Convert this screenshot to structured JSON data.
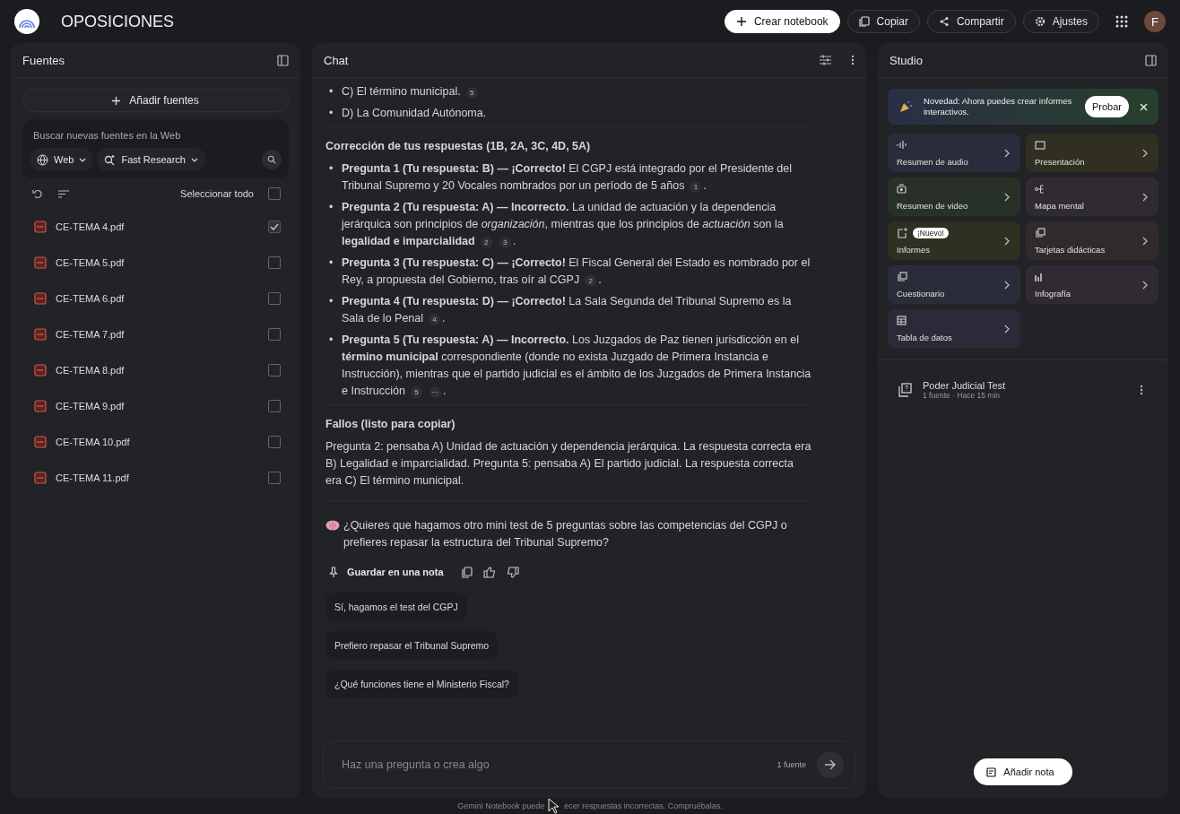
{
  "header": {
    "title": "OPOSICIONES",
    "buttons": [
      {
        "kind": "create",
        "label": "Crear notebook"
      },
      {
        "kind": "copy",
        "label": "Copiar"
      },
      {
        "kind": "share",
        "label": "Compartir"
      },
      {
        "kind": "settings",
        "label": "Ajustes"
      }
    ],
    "avatar": "F"
  },
  "sources": {
    "title": "Fuentes",
    "add_button": "Añadir fuentes",
    "search": {
      "placeholder": "Buscar nuevas fuentes en la Web",
      "web_button": "Web",
      "research_button": "Fast Research"
    },
    "select_all": {
      "label": "Seleccionar todo",
      "checked": false
    },
    "items": [
      {
        "name": "CE-TEMA 4.pdf",
        "checked": true
      },
      {
        "name": "CE-TEMA 5.pdf",
        "checked": false
      },
      {
        "name": "CE-TEMA 6.pdf",
        "checked": false
      },
      {
        "name": "CE-TEMA 7.pdf",
        "checked": false
      },
      {
        "name": "CE-TEMA 8.pdf",
        "checked": false
      },
      {
        "name": "CE-TEMA 9.pdf",
        "checked": false
      },
      {
        "name": "CE-TEMA 10.pdf",
        "checked": false
      },
      {
        "name": "CE-TEMA 11.pdf",
        "checked": false
      }
    ]
  },
  "chat": {
    "title": "Chat",
    "options": [
      {
        "text": "C) El término municipal.",
        "citations": [
          "5"
        ]
      },
      {
        "text": "D) La Comunidad Autónoma."
      }
    ],
    "bullet": "•",
    "correction_heading": "Corrección de tus respuestas (1B, 2A, 3C, 4D, 5A)",
    "corrections": [
      {
        "text": "**Pregunta 1 (Tu respuesta: B) — ¡Correcto!** El CGPJ está integrado por el Presidente del Tribunal Supremo y 20 Vocales nombrados por un período de 5 años",
        "citations": [
          "1"
        ],
        "end": "."
      },
      {
        "text": "**Pregunta 2 (Tu respuesta: A) — Incorrecto.** La unidad de actuación y la dependencia jerárquica son principios de *organización*, mientras que los principios de *actuación* son la **legalidad e imparcialidad**",
        "citations": [
          "2",
          "3"
        ],
        "end": "."
      },
      {
        "text": "**Pregunta 3 (Tu respuesta: C) — ¡Correcto!** El Fiscal General del Estado es nombrado por el Rey, a propuesta del Gobierno, tras oír al CGPJ",
        "citations": [
          "2"
        ],
        "end": "."
      },
      {
        "text": "**Pregunta 4 (Tu respuesta: D) — ¡Correcto!** La Sala Segunda del Tribunal Supremo es la Sala de lo Penal",
        "citations": [
          "4"
        ],
        "end": "."
      },
      {
        "text": "**Pregunta 5 (Tu respuesta: A) — Incorrecto.** Los Juzgados de Paz tienen jurisdicción en el **término municipal** correspondiente (donde no exista Juzgado de Primera Instancia e Instrucción), mientras que el partido judicial es el ámbito de los Juzgados de Primera Instancia e Instrucción",
        "citations": [
          "5",
          "⋯"
        ],
        "end": "."
      }
    ],
    "fallos_heading": "Fallos (listo para copiar)",
    "fallos_text": "Pregunta 2: pensaba A) Unidad de actuación y dependencia jerárquica. La respuesta correcta era B) Legalidad e imparcialidad. Pregunta 5: pensaba A) El partido judicial. La respuesta correcta era C) El término municipal.",
    "question": "¿Quieres que hagamos otro mini test de 5 preguntas sobre las competencias del CGPJ o prefieres repasar la estructura del Tribunal Supremo?",
    "save_note": "Guardar en una nota",
    "suggestions": [
      "Sí, hagamos el test del CGPJ",
      "Prefiero repasar el Tribunal Supremo",
      "¿Qué funciones tiene el Ministerio Fiscal?"
    ],
    "input": {
      "placeholder": "Haz una pregunta o crea algo",
      "source_count": "1 fuente"
    }
  },
  "studio": {
    "title": "Studio",
    "banner": {
      "text": "Novedad: Ahora puedes crear informes interactivos.",
      "button": "Probar"
    },
    "tiles": [
      {
        "kind": "audio",
        "label": "Resumen de audio",
        "color": "#2a2c3b"
      },
      {
        "kind": "slides",
        "label": "Presentación",
        "color": "#302f22"
      },
      {
        "kind": "video",
        "label": "Resumen de video",
        "color": "#283127"
      },
      {
        "kind": "mindmap",
        "label": "Mapa mental",
        "color": "#302a32"
      },
      {
        "kind": "report",
        "label": "Informes",
        "badge": "¡Nuevo!",
        "color": "#2f2f22"
      },
      {
        "kind": "cards",
        "label": "Tarjetas didácticas",
        "color": "#312a2b"
      },
      {
        "kind": "quiz",
        "label": "Cuestionario",
        "color": "#2a2d39"
      },
      {
        "kind": "infographic",
        "label": "Infografía",
        "color": "#302a33"
      },
      {
        "kind": "table",
        "label": "Tabla de datos",
        "color": "#2b2a38"
      }
    ],
    "notes": [
      {
        "title": "Poder Judicial Test",
        "meta": "1 fuente · Hace 15 min"
      }
    ],
    "add_note": "Añadir nota"
  },
  "footer": {
    "text_before_cursor": "Gemini Notebook puede",
    "text_after_cursor": "ecer respuestas incorrectas. Compruébalas."
  }
}
